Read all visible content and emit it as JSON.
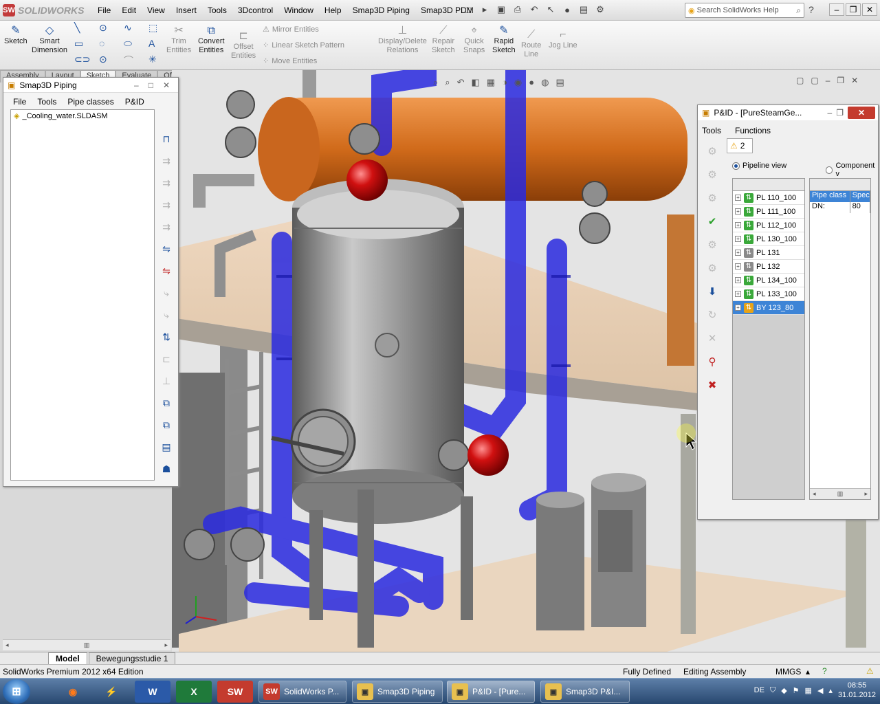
{
  "app": {
    "logo_text": "SOLIDWORKS",
    "logo_mark": "SW"
  },
  "menubar": [
    "File",
    "Edit",
    "View",
    "Insert",
    "Tools",
    "3Dcontrol",
    "Window",
    "Help",
    "Smap3D Piping",
    "Smap3D PDM"
  ],
  "search": {
    "placeholder": "Search SolidWorks Help"
  },
  "ribbon": {
    "sketch": "Sketch",
    "smart_dimension": [
      "Smart",
      "Dimension"
    ],
    "trim_entities": [
      "Trim",
      "Entities"
    ],
    "convert_entities": [
      "Convert",
      "Entities"
    ],
    "offset_entities": [
      "Offset",
      "Entities"
    ],
    "mirror_entities": "Mirror Entities",
    "linear_sketch_pattern": "Linear Sketch Pattern",
    "move_entities": "Move Entities",
    "display_delete_relations": [
      "Display/Delete",
      "Relations"
    ],
    "repair_sketch": [
      "Repair",
      "Sketch"
    ],
    "quick_snaps": [
      "Quick",
      "Snaps"
    ],
    "rapid_sketch": [
      "Rapid",
      "Sketch"
    ],
    "route_line": [
      "Route",
      "Line"
    ],
    "jog_line": "Jog Line"
  },
  "tabs": [
    "Assembly",
    "Layout",
    "Sketch",
    "Evaluate",
    "Office Products"
  ],
  "smap": {
    "title": "Smap3D Piping",
    "menu": [
      "File",
      "Tools",
      "Pipe classes",
      "P&ID"
    ],
    "tree_root": "_Cooling_water.SLDASM"
  },
  "pid": {
    "title": "P&ID - [PureSteamGe...",
    "menu": [
      "Tools",
      "Functions"
    ],
    "tab_label": "2",
    "radio_pipeline": "Pipeline view",
    "radio_component": "Component v",
    "pipelines": [
      {
        "label": "PL 110_100",
        "color": "#3aa83a"
      },
      {
        "label": "PL 111_100",
        "color": "#3aa83a"
      },
      {
        "label": "PL 112_100",
        "color": "#3aa83a"
      },
      {
        "label": "PL 130_100",
        "color": "#3aa83a"
      },
      {
        "label": "PL 131",
        "color": "#8a8a8a"
      },
      {
        "label": "PL 132",
        "color": "#8a8a8a"
      },
      {
        "label": "PL 134_100",
        "color": "#3aa83a"
      },
      {
        "label": "PL 133_100",
        "color": "#3aa83a"
      },
      {
        "label": "BY 123_80",
        "color": "#e8a317",
        "selected": true
      }
    ],
    "table_headers": [
      "Pipe class",
      "Spec"
    ],
    "table_row": [
      "DN:",
      "80"
    ]
  },
  "modeltabs": [
    "Model",
    "Bewegungsstudie 1"
  ],
  "status": {
    "edition": "SolidWorks Premium 2012 x64 Edition",
    "defined": "Fully Defined",
    "mode": "Editing Assembly",
    "units": "MMGS"
  },
  "taskbar": {
    "buttons": [
      "SolidWorks P...",
      "Smap3D Piping",
      "P&ID - [Pure...",
      "Smap3D P&I..."
    ],
    "pinned_sw": "SW",
    "lang": "DE",
    "time": "08:55",
    "date": "31.01.2012"
  },
  "colors": {
    "pipe_blue": "#2a2ae0",
    "vessel_orange": "#d06a1a",
    "ball_red": "#d01010",
    "selection": "#3d84d6"
  }
}
